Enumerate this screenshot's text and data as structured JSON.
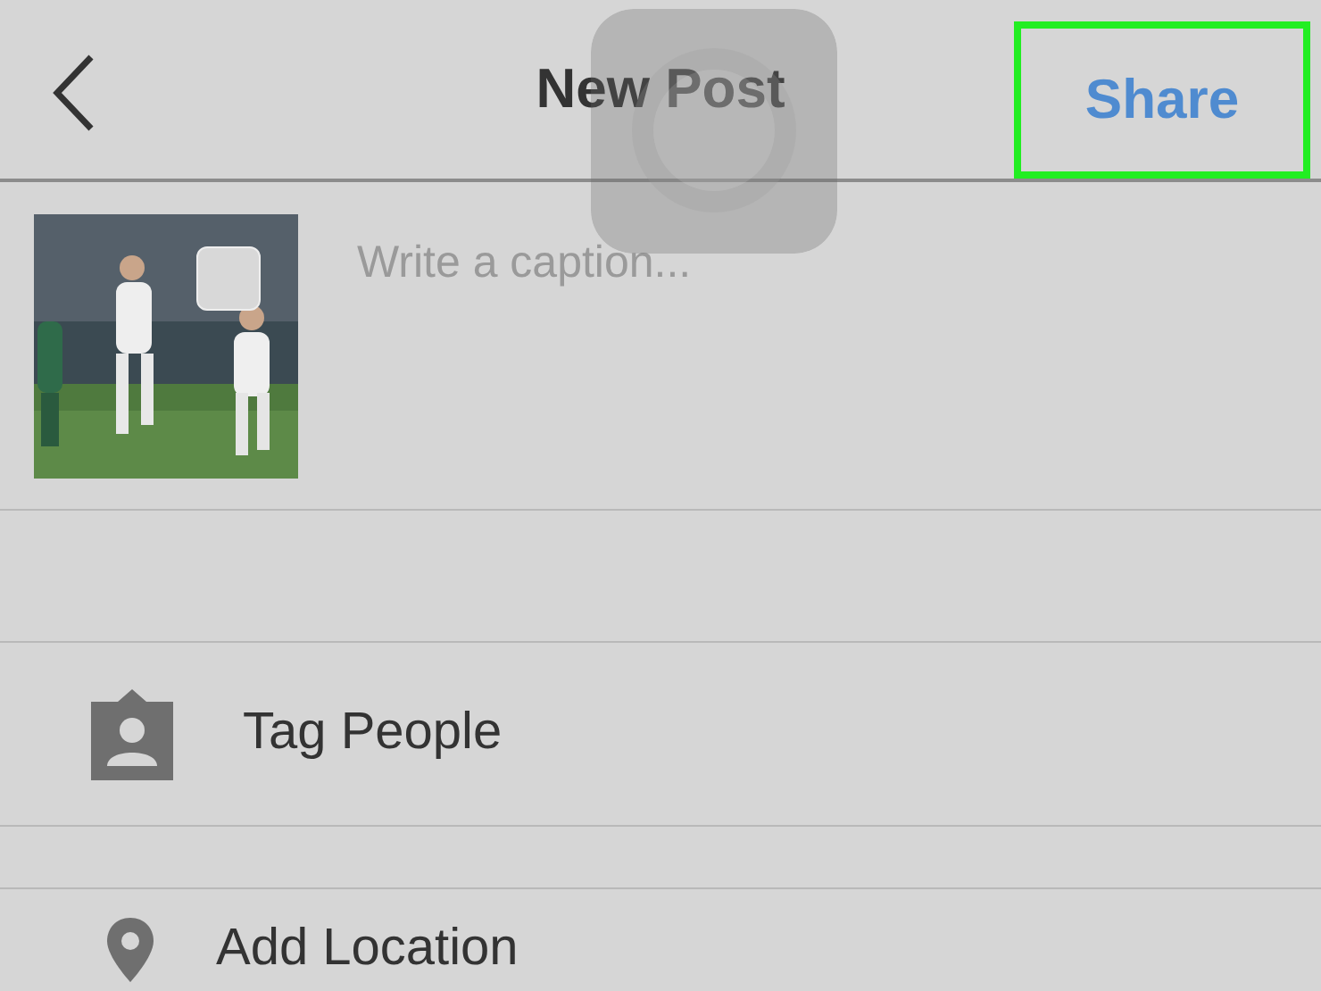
{
  "header": {
    "title": "New Post",
    "share": {
      "label": "Share",
      "highlighted": true
    }
  },
  "post": {
    "caption": {
      "placeholder": "Write a caption..."
    }
  },
  "options": [
    {
      "label": "Tag People",
      "kind": "tag"
    },
    {
      "label": "Add Location",
      "kind": "location"
    }
  ]
}
